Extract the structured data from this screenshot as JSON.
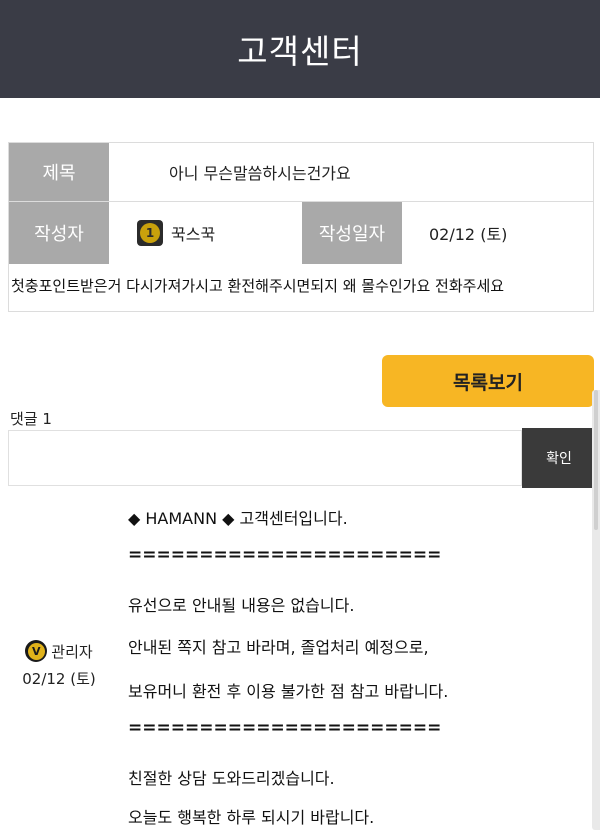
{
  "header": {
    "title": "고객센터"
  },
  "post": {
    "subject_label": "제목",
    "subject": "아니 무슨말씀하시는건가요",
    "author_label": "작성자",
    "author_badge": "1",
    "author": "꾹스꾹",
    "date_label": "작성일자",
    "date": "02/12 (토)",
    "body": "첫충포인트받은거 다시가져가시고 환전해주시면되지 왜 몰수인가요 전화주세요"
  },
  "actions": {
    "list_label": "목록보기"
  },
  "comments": {
    "count_label": "댓글 1",
    "input_placeholder": "",
    "confirm_label": "확인",
    "items": [
      {
        "badge": "V",
        "author": "관리자",
        "date": "02/12 (토)",
        "lines": [
          "◆ HAMANN ◆ 고객센터입니다.",
          "======================",
          "유선으로 안내될 내용은 없습니다.",
          "안내된 쪽지 참고 바라며, 졸업처리 예정으로,",
          "보유머니 환전 후 이용 불가한 점 참고 바랍니다.",
          "======================",
          "친절한 상담 도와드리겠습니다.",
          "오늘도 행복한 하루 되시기 바랍니다."
        ]
      }
    ]
  },
  "colors": {
    "header_bg": "#3a3c46",
    "label_bg": "#a9a9a9",
    "list_button": "#f7b624",
    "confirm_button": "#3a3a3a"
  }
}
